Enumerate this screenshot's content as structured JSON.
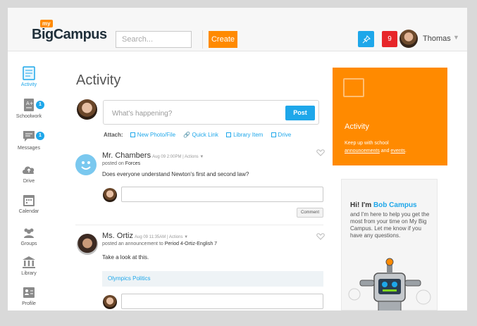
{
  "header": {
    "logo_small": "my",
    "logo_text": "BigCampus",
    "search_placeholder": "Search...",
    "create_label": "Create",
    "notification_count": "9",
    "user_name": "Thomas",
    "accent_color": "#1ea7ea",
    "brand_color": "#ff8a00"
  },
  "sidebar": {
    "items": [
      {
        "label": "Activity",
        "icon": "activity-icon",
        "active": true
      },
      {
        "label": "Schoolwork",
        "icon": "schoolwork-icon",
        "badge": "1"
      },
      {
        "label": "Messages",
        "icon": "messages-icon",
        "badge": "1"
      },
      {
        "label": "Drive",
        "icon": "cloud-icon"
      },
      {
        "label": "Calendar",
        "icon": "calendar-icon"
      },
      {
        "label": "Groups",
        "icon": "groups-icon"
      },
      {
        "label": "Library",
        "icon": "library-icon"
      },
      {
        "label": "Profile",
        "icon": "profile-icon"
      }
    ]
  },
  "main": {
    "title": "Activity",
    "composer": {
      "placeholder": "What's happening?",
      "post_label": "Post",
      "attach_label": "Attach:",
      "attachments": [
        "New Photo/File",
        "Quick Link",
        "Library Item",
        "Drive"
      ]
    },
    "posts": [
      {
        "author": "Mr. Chambers",
        "meta": "Aug 09 2:00PM | Actions ▼",
        "posted_prefix": "posted on",
        "posted_target": "Forces",
        "text": "Does everyone understand Newton's first and second law?",
        "comment_label": "Comment"
      },
      {
        "author": "Ms. Ortiz",
        "meta": "Aug 09 11:35AM | Actions ▼",
        "posted_prefix": "posted an announcement to",
        "posted_target": "Period 4-Ortiz-English 7",
        "text": "Take a look at this.",
        "link_title": "Olympics Politics"
      }
    ]
  },
  "right": {
    "activity_card": {
      "title": "Activity",
      "desc_prefix": "Keep up with school",
      "link1": "announcements",
      "and": "and",
      "link2": "events",
      "period": "."
    },
    "bob_card": {
      "hi_prefix": "Hi! I'm",
      "name": "Bob Campus",
      "body": "and I'm here to help you get the most from your time on My Big Campus. Let me know if you have any questions."
    }
  }
}
